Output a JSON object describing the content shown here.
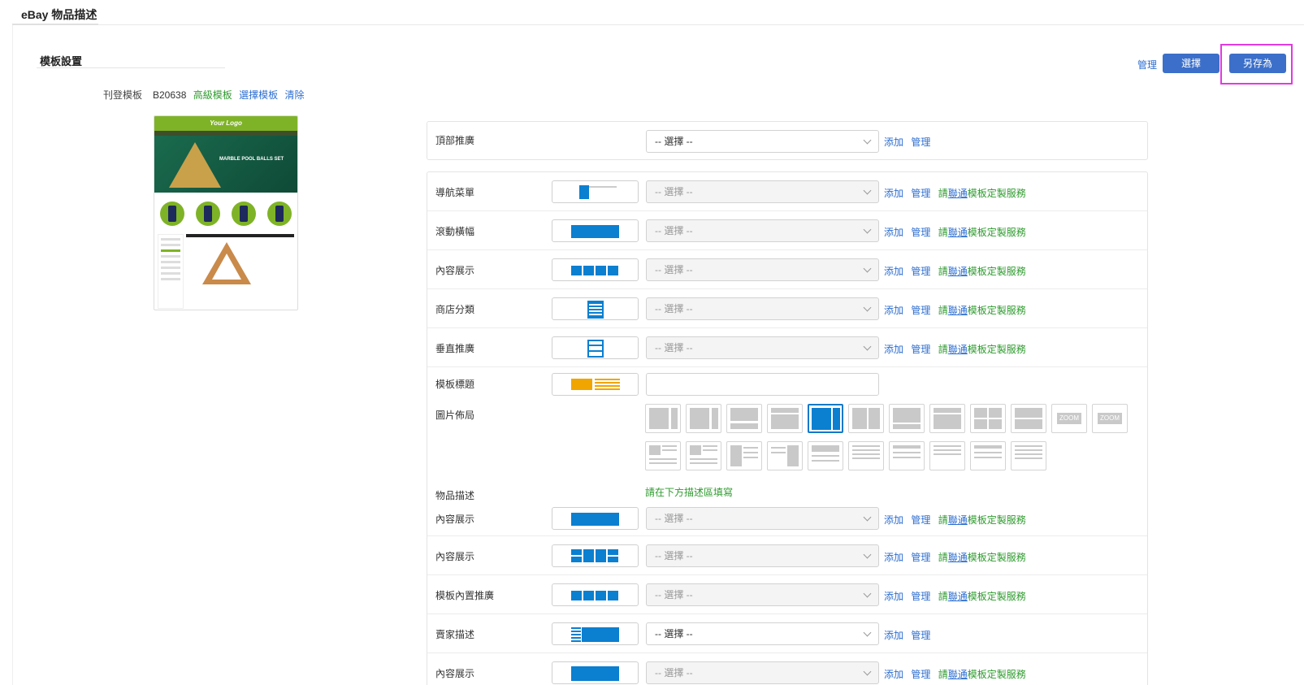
{
  "header": {
    "title": "eBay 物品描述"
  },
  "section": {
    "title": "模板設置"
  },
  "toolbar": {
    "manage": "管理",
    "select": "選擇",
    "save_as": "另存為"
  },
  "publish": {
    "label": "刊登模板",
    "code": "B20638",
    "advanced": "高級模板",
    "choose": "選擇模板",
    "clear": "清除"
  },
  "preview": {
    "logo_text": "Your Logo",
    "banner_text": "MARBLE POOL BALLS SET"
  },
  "common": {
    "add": "添加",
    "manage": "管理",
    "please": "請",
    "contact": "聯通",
    "custom_service": "模板定製服務",
    "select_placeholder": "-- 選擇 --"
  },
  "top_row": {
    "label": "頂部推廣",
    "select_value": "-- 選擇 --"
  },
  "rows": [
    {
      "label": "導航菜單"
    },
    {
      "label": "滾動橫幅"
    },
    {
      "label": "內容展示"
    },
    {
      "label": "商店分類"
    },
    {
      "label": "垂直推廣"
    }
  ],
  "template_title": {
    "label": "模板標題"
  },
  "image_layout": {
    "label": "圖片佈局",
    "zoom_label": "ZOOM",
    "selected_index": 4
  },
  "item_desc": {
    "label": "物品描述",
    "hint": "請在下方描述區填寫"
  },
  "rows2": [
    {
      "label": "內容展示"
    },
    {
      "label": "內容展示"
    },
    {
      "label": "模板內置推廣"
    },
    {
      "label": "賣家描述",
      "select_value": "-- 選擇 --"
    },
    {
      "label": "內容展示"
    }
  ],
  "colors": {
    "accent": "#3b6fc9",
    "link": "#2d6ed0",
    "green": "#2e9a2e",
    "thumb_blue": "#0b7fd0",
    "highlight": "#e23ae0"
  }
}
